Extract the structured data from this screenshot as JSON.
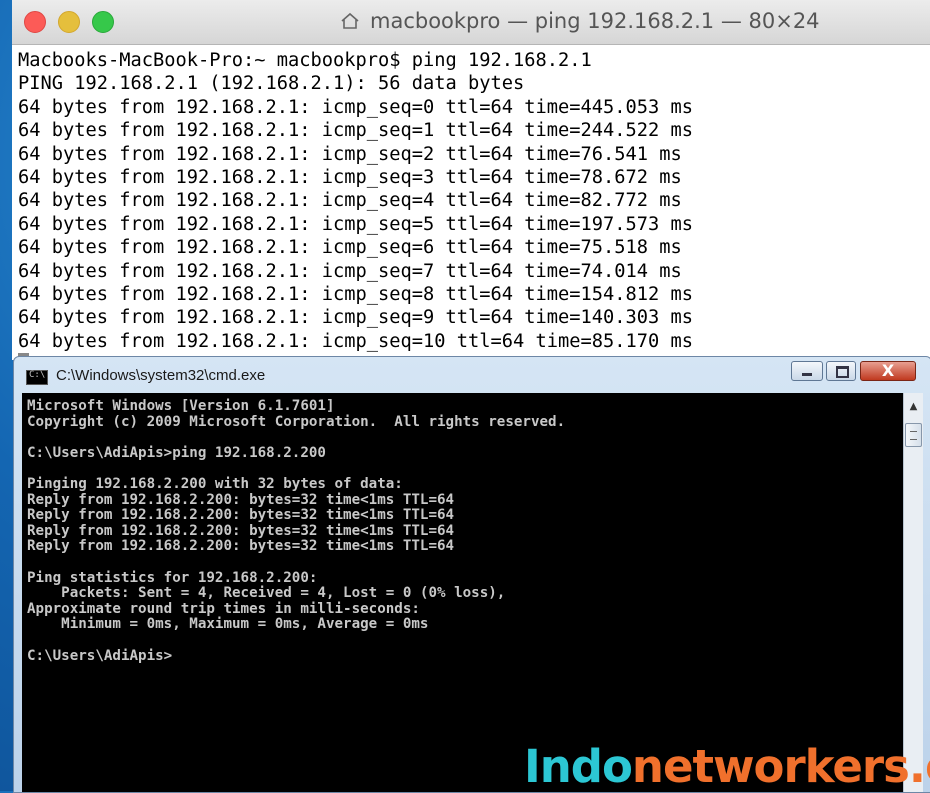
{
  "mac_terminal": {
    "title": "macbookpro — ping 192.168.2.1 — 80×24",
    "lines": [
      "Macbooks-MacBook-Pro:~ macbookpro$ ping 192.168.2.1",
      "PING 192.168.2.1 (192.168.2.1): 56 data bytes",
      "64 bytes from 192.168.2.1: icmp_seq=0 ttl=64 time=445.053 ms",
      "64 bytes from 192.168.2.1: icmp_seq=1 ttl=64 time=244.522 ms",
      "64 bytes from 192.168.2.1: icmp_seq=2 ttl=64 time=76.541 ms",
      "64 bytes from 192.168.2.1: icmp_seq=3 ttl=64 time=78.672 ms",
      "64 bytes from 192.168.2.1: icmp_seq=4 ttl=64 time=82.772 ms",
      "64 bytes from 192.168.2.1: icmp_seq=5 ttl=64 time=197.573 ms",
      "64 bytes from 192.168.2.1: icmp_seq=6 ttl=64 time=75.518 ms",
      "64 bytes from 192.168.2.1: icmp_seq=7 ttl=64 time=74.014 ms",
      "64 bytes from 192.168.2.1: icmp_seq=8 ttl=64 time=154.812 ms",
      "64 bytes from 192.168.2.1: icmp_seq=9 ttl=64 time=140.303 ms",
      "64 bytes from 192.168.2.1: icmp_seq=10 ttl=64 time=85.170 ms"
    ]
  },
  "cmd_window": {
    "title": "C:\\Windows\\system32\\cmd.exe",
    "icon_label": "C:\\",
    "close_label": "X",
    "lines": [
      "Microsoft Windows [Version 6.1.7601]",
      "Copyright (c) 2009 Microsoft Corporation.  All rights reserved.",
      "",
      "C:\\Users\\AdiApis>ping 192.168.2.200",
      "",
      "Pinging 192.168.2.200 with 32 bytes of data:",
      "Reply from 192.168.2.200: bytes=32 time<1ms TTL=64",
      "Reply from 192.168.2.200: bytes=32 time<1ms TTL=64",
      "Reply from 192.168.2.200: bytes=32 time<1ms TTL=64",
      "Reply from 192.168.2.200: bytes=32 time<1ms TTL=64",
      "",
      "Ping statistics for 192.168.2.200:",
      "    Packets: Sent = 4, Received = 4, Lost = 0 (0% loss),",
      "Approximate round trip times in milli-seconds:",
      "    Minimum = 0ms, Maximum = 0ms, Average = 0ms",
      "",
      "C:\\Users\\AdiApis>"
    ]
  },
  "watermark": {
    "part1": "Indo",
    "part2": "networkers.c"
  },
  "colors": {
    "background": "#1466b2",
    "watermark_teal": "#2cc7d4",
    "watermark_orange": "#f0702c",
    "close_red": "#c0391f"
  },
  "icons": {
    "mac_window_controls": [
      "close-traffic-light",
      "minimize-traffic-light",
      "zoom-traffic-light"
    ],
    "title_icon": "home-icon",
    "cmd_icon": "command-prompt-icon"
  }
}
